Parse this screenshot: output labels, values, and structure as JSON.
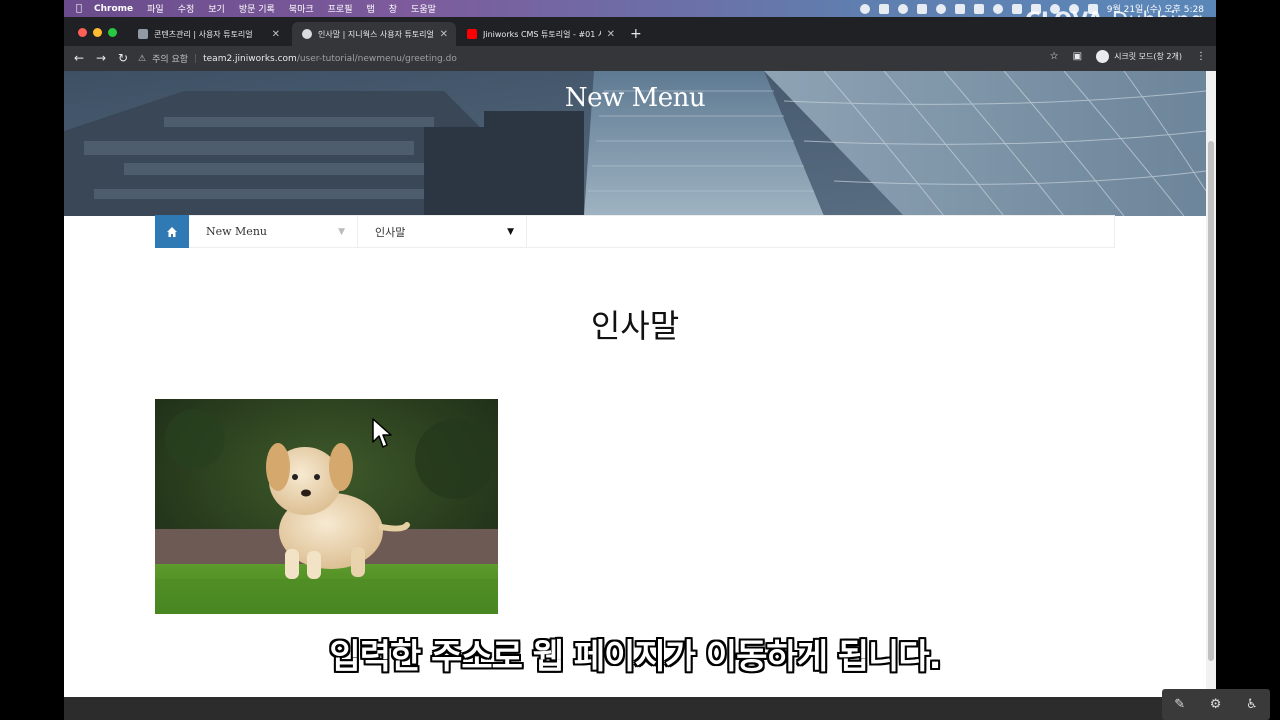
{
  "menubar": {
    "app": "Chrome",
    "items": [
      "파일",
      "수정",
      "보기",
      "방문 기록",
      "북마크",
      "프로필",
      "탭",
      "창",
      "도움말"
    ],
    "datetime": "9월 21일 (수) 오후 5:28"
  },
  "watermark": {
    "bold": "CLOVA",
    "light": "Dubbing"
  },
  "tabs": [
    {
      "title": "콘텐츠관리 | 사용자 튜토리얼",
      "color": "#8f9aa6"
    },
    {
      "title": "인사말 | 지니웍스 사용자 튜토리얼",
      "color": "#9aa0a6"
    },
    {
      "title": "Jiniworks CMS 튜토리얼 - #01 사",
      "color": "#ff0000"
    }
  ],
  "toolbar": {
    "security_label": "주의 요함",
    "url_host": "team2.jiniworks.com",
    "url_path": "/user-tutorial/newmenu/greeting.do",
    "incognito_label": "시크릿 모드(창 2개)"
  },
  "page": {
    "hero_title": "New Menu",
    "nav": {
      "menu": "New Menu",
      "submenu": "인사말"
    },
    "title": "인사말"
  },
  "subtitle": "입력한 주소로 웹 페이지가 이동하게 됩니다.",
  "colors": {
    "accent": "#2f7ab5",
    "menubar_start": "#6a4c8c",
    "menubar_end": "#5a87b8"
  }
}
